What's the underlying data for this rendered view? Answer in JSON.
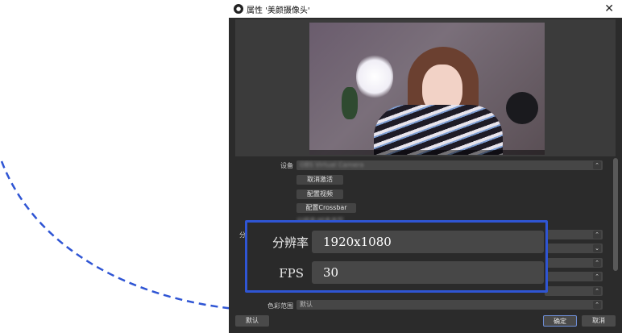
{
  "window": {
    "title": "属性 '美颜摄像头'",
    "close_glyph": "✕"
  },
  "preview": {
    "controls": "❚❚ ⟲"
  },
  "properties": {
    "device_label": "设备",
    "device_value": "OBS Virtual Camera",
    "deactivate_label": "取消激活",
    "configure_video_label": "配置视频",
    "configure_crossbar_label": "配置Crossbar",
    "hidden_checkbox_label": "分辨率/帧率类型",
    "cut_off_label": "分",
    "color_range_label": "色彩范围",
    "color_range_value": "默认"
  },
  "zoom_overlay": {
    "resolution_label": "分辨率",
    "resolution_value": "1920x1080",
    "fps_label": "FPS",
    "fps_value": "30"
  },
  "footer": {
    "defaults_label": "默认",
    "ok_label": "确定",
    "cancel_label": "取消"
  },
  "colors": {
    "highlight_border": "#2f55d4",
    "dashed_arc": "#2f55d4",
    "dialog_background": "#2b2b2b"
  }
}
